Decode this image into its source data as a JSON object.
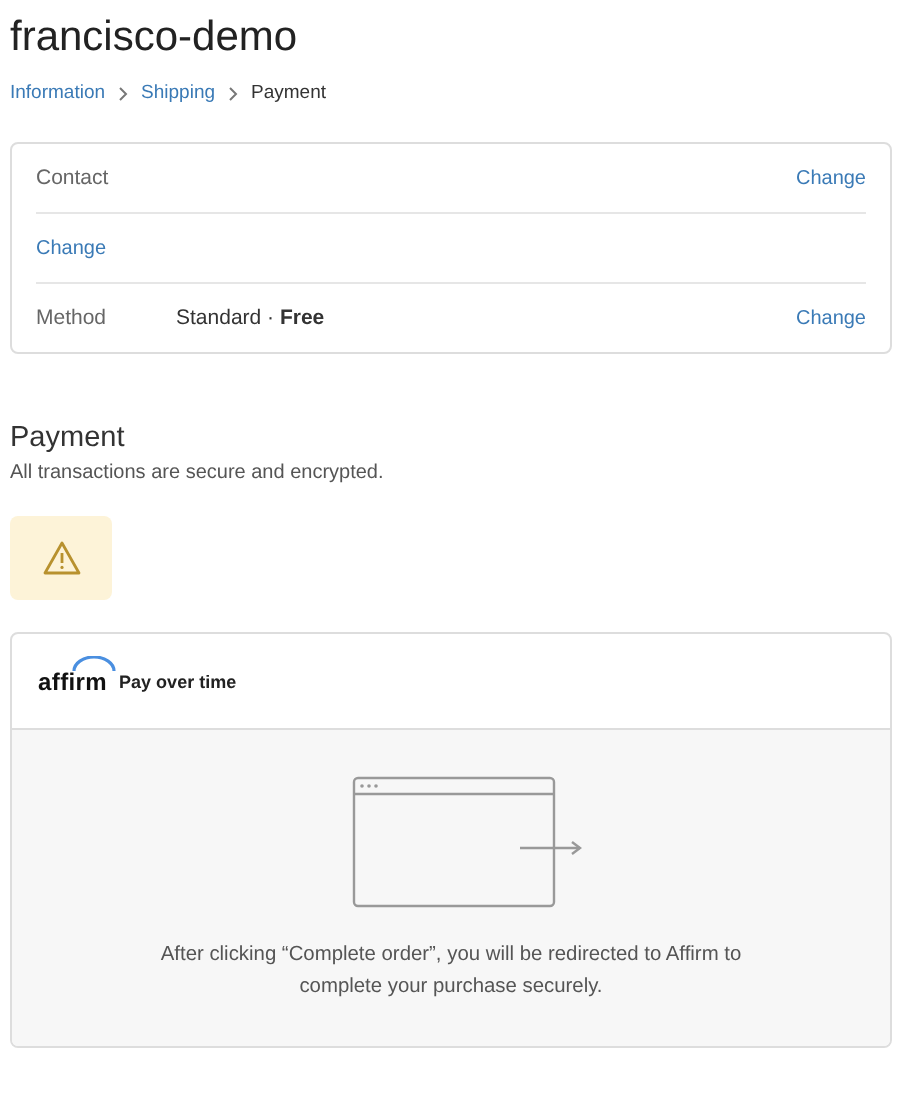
{
  "store_title": "francisco-demo",
  "breadcrumbs": [
    {
      "label": "Information",
      "selected": false
    },
    {
      "label": "Shipping",
      "selected": false
    },
    {
      "label": "Payment",
      "selected": true
    }
  ],
  "review_rows": [
    {
      "label": "Contact",
      "action": "Change"
    },
    {
      "action": "Change"
    },
    {
      "label": "Method",
      "value": "Standard · **Free**",
      "action": "Change"
    }
  ],
  "payment": {
    "heading": "Payment",
    "subtitle": "All transactions are secure and encrypted.",
    "warning": true,
    "method": {
      "logo": "affirm",
      "title": "Pay over time",
      "message": "After clicking “Complete order”, you will be redirected to Affirm to complete your purchase securely."
    }
  }
}
